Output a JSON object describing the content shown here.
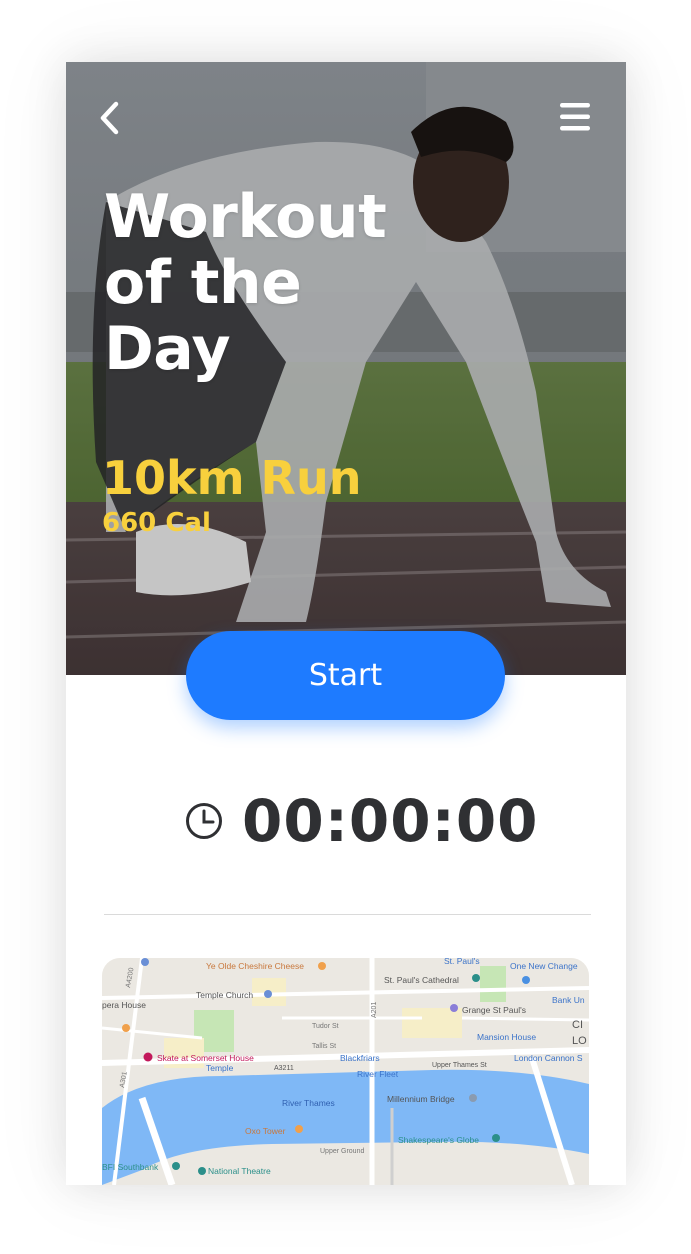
{
  "hero": {
    "title": "Workout of the Day",
    "workout_name": "10km Run",
    "calories": "660 Cal"
  },
  "actions": {
    "start_label": "Start"
  },
  "timer": {
    "value": "00:00:00"
  },
  "icons": {
    "back": "chevron-left-icon",
    "menu": "hamburger-menu-icon",
    "timer": "clock-icon"
  },
  "colors": {
    "accent": "#1e7bff",
    "highlight": "#f8d03d",
    "text_dark": "#2f3033",
    "river": "#7fb8f6"
  },
  "map": {
    "labels": [
      "Ye Olde Cheshire Cheese",
      "St. Paul's",
      "One New Change",
      "Temple Church",
      "St. Paul's Cathedral",
      "Bank Un",
      "pera House",
      "Grange St Paul's",
      "CI",
      "Tudor St",
      "LO",
      "Mansion House",
      "Tallis St",
      "Skate at Somerset House",
      "Blackfriars",
      "London Cannon S",
      "Temple",
      "A3211",
      "River Fleet",
      "Upper Thames St",
      "River Thames",
      "Millennium Bridge",
      "Oxo Tower",
      "Shakespeare's Globe",
      "Upper Ground",
      "BFI Southbank",
      "National Theatre",
      "A4200",
      "A301",
      "A201"
    ]
  }
}
